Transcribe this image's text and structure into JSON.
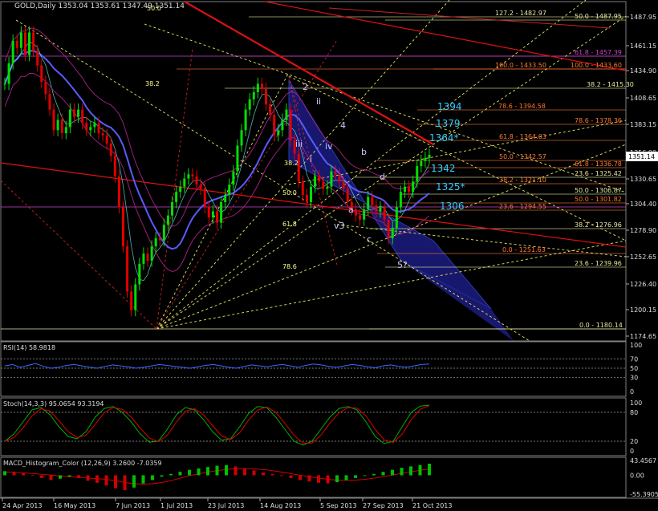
{
  "chart_data": {
    "type": "line",
    "title": "GOLD,Daily",
    "ohlc_readout": "1353.04 1353.61 1347.49 1351.14",
    "last_price": "1351.14",
    "price_axis": {
      "range": [
        1170,
        1500
      ],
      "ticks": [
        "1487.95",
        "1461.15",
        "1434.90",
        "1408.65",
        "1383.15",
        "1356.90",
        "1330.65",
        "1304.40",
        "1278.90",
        "1252.65",
        "1226.40",
        "1200.15",
        "1174.65"
      ]
    },
    "x_ticks": [
      "24 Apr 2013",
      "16 May 2013",
      "7 Jun 2013",
      "1 Jul 2013",
      "23 Jul 2013",
      "14 Aug 2013",
      "5 Sep 2013",
      "27 Sep 2013",
      "21 Oct 2013"
    ],
    "series": [
      {
        "name": "price",
        "values": [
          1420,
          1440,
          1462,
          1455,
          1470,
          1448,
          1470,
          1452,
          1438,
          1422,
          1410,
          1395,
          1375,
          1385,
          1372,
          1378,
          1395,
          1388,
          1395,
          1382,
          1375,
          1378,
          1382,
          1372,
          1370,
          1362,
          1350,
          1330,
          1300,
          1262,
          1218,
          1200,
          1225,
          1245,
          1255,
          1248,
          1262,
          1270,
          1268,
          1283,
          1292,
          1305,
          1315,
          1320,
          1328,
          1332,
          1330,
          1322,
          1318,
          1300,
          1290,
          1296,
          1285,
          1305,
          1312,
          1322,
          1335,
          1360,
          1375,
          1395,
          1405,
          1412,
          1420,
          1415,
          1400,
          1390,
          1370,
          1375,
          1385,
          1395,
          1365,
          1352,
          1325,
          1312,
          1305,
          1320,
          1330,
          1325,
          1318,
          1320,
          1335,
          1332,
          1325,
          1318,
          1305,
          1298,
          1292,
          1288,
          1298,
          1310,
          1302,
          1296,
          1300,
          1288,
          1270,
          1280,
          1300,
          1315,
          1320,
          1315,
          1325,
          1340,
          1345,
          1348,
          1351
        ]
      }
    ],
    "fib_levels": [
      {
        "label": "127.2 - 1482.97",
        "color": "#e8e8a0"
      },
      {
        "label": "50.0 - 1487.95",
        "color": "#e8e8a0"
      },
      {
        "label": "61.8 - 1457.39",
        "color": "#cc44cc"
      },
      {
        "label": "100.0 - 1433.50",
        "color": "#ff7a30"
      },
      {
        "label": "100.0 - 1433.60",
        "color": "#ff7a30"
      },
      {
        "label": "38.2 - 1415.30",
        "color": "#e8e8a0"
      },
      {
        "label": "78.6 - 1394.58",
        "color": "#ff7a30"
      },
      {
        "label": "78.6 - 1378.36",
        "color": "#ff7a30"
      },
      {
        "label": "61.8 - 1364.03",
        "color": "#ff7a30"
      },
      {
        "label": "50.0 - 1342.57",
        "color": "#ff7a30"
      },
      {
        "label": "61.8 - 1336.78",
        "color": "#ff7a30"
      },
      {
        "label": "23.6 - 1325.42",
        "color": "#e8e8a0"
      },
      {
        "label": "38.2 - 1321.10",
        "color": "#ff7a30"
      },
      {
        "label": "50.0 - 1306.87",
        "color": "#e8e8a0"
      },
      {
        "label": "50.0 - 1301.82",
        "color": "#ff7a30"
      },
      {
        "label": "23.6 - 1294.55",
        "color": "#ff7a30"
      },
      {
        "label": "38.2 - 1276.96",
        "color": "#e8e8a0"
      },
      {
        "label": "0.0 - 1251.63",
        "color": "#ff7a30"
      },
      {
        "label": "23.6 - 1239.96",
        "color": "#e8e8a0"
      },
      {
        "label": "0.0 - 1180.14",
        "color": "#e8e8a0"
      }
    ],
    "cyan_targets": [
      "1394",
      "1379",
      "1364*",
      "1342",
      "1325*",
      "1306"
    ],
    "fan_labels": [
      "50.0",
      "38.2",
      "38.2",
      "50.0",
      "61.8",
      "78.6"
    ],
    "wave_labels": [
      "2",
      "ii",
      "4",
      "iii",
      "b",
      "iv",
      "i",
      "d",
      "a",
      "v3",
      "c",
      "5?"
    ],
    "rsi": {
      "header": "RSI(14) 58.9818",
      "ticks": [
        "100",
        "70",
        "50",
        "30",
        "0"
      ],
      "values": [
        55,
        58,
        52,
        56,
        60,
        54,
        50,
        52,
        56,
        58,
        55,
        52,
        50,
        54,
        57,
        55,
        53,
        50,
        52,
        55,
        58,
        56,
        54,
        52,
        50,
        53,
        56,
        58,
        55,
        52,
        50,
        54,
        57,
        55,
        53,
        56,
        58,
        55,
        52,
        56,
        59,
        57,
        54,
        52,
        55,
        58,
        56,
        53,
        51,
        55,
        57,
        54,
        52,
        55,
        58,
        59
      ]
    },
    "stoch": {
      "header": "Stoch(14,3,3) 95.0654 93.3194",
      "ticks": [
        "100",
        "80",
        "20",
        "0"
      ],
      "values": [
        20,
        35,
        60,
        85,
        90,
        75,
        50,
        30,
        25,
        40,
        70,
        88,
        92,
        80,
        60,
        35,
        18,
        20,
        45,
        75,
        90,
        85,
        65,
        40,
        22,
        25,
        50,
        78,
        92,
        90,
        70,
        45,
        20,
        12,
        20,
        45,
        70,
        88,
        92,
        85,
        60,
        30,
        15,
        20,
        50,
        80,
        93,
        95
      ]
    },
    "macd": {
      "header": "MACD_Histogram_Color (12,26,9) 3.2600 -7.0359",
      "ticks": [
        "43.4567",
        "0.00",
        "-55.3905"
      ],
      "values": [
        12,
        10,
        6,
        -2,
        -8,
        -14,
        -10,
        -4,
        -8,
        -16,
        -22,
        -30,
        -38,
        -44,
        -36,
        -24,
        -14,
        -4,
        4,
        10,
        16,
        20,
        24,
        28,
        30,
        26,
        20,
        14,
        8,
        4,
        -2,
        -8,
        -14,
        -18,
        -22,
        -24,
        -20,
        -14,
        -8,
        -2,
        4,
        10,
        16,
        22,
        26,
        30,
        34
      ]
    },
    "colors": {
      "background": "#000000",
      "candle_up": "#00e000",
      "candle_down": "#e00000",
      "ma_blue": "#5a5aff",
      "triangle_fill": "#1c1c80",
      "red_trend": "#dd1111",
      "yellow_dashed": "#e8e860",
      "cyan_label": "#33ccff",
      "rsi_line": "#3a6aff"
    }
  }
}
